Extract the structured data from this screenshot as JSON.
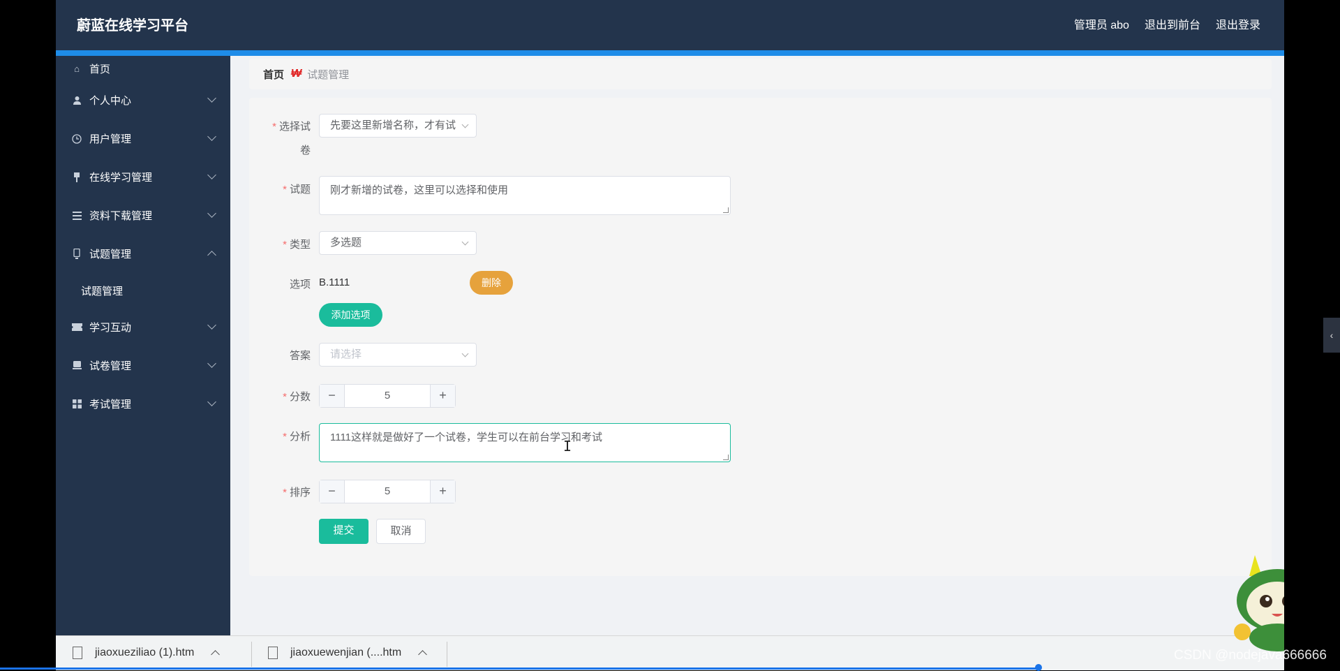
{
  "header": {
    "app_title": "蔚蓝在线学习平台",
    "admin_label": "管理员 abo",
    "back_to_front": "退出到前台",
    "logout": "退出登录"
  },
  "sidebar": {
    "items": [
      {
        "label": "首页",
        "icon": "home-icon"
      },
      {
        "label": "个人中心",
        "icon": "user-icon"
      },
      {
        "label": "用户管理",
        "icon": "clock-icon"
      },
      {
        "label": "在线学习管理",
        "icon": "pin-icon"
      },
      {
        "label": "资料下载管理",
        "icon": "list-icon"
      },
      {
        "label": "试题管理",
        "icon": "device-icon"
      },
      {
        "label": "试题管理"
      },
      {
        "label": "学习互动",
        "icon": "ticket-icon"
      },
      {
        "label": "试卷管理",
        "icon": "paper-icon"
      },
      {
        "label": "考试管理",
        "icon": "grid-icon"
      }
    ]
  },
  "breadcrumb": {
    "home": "首页",
    "current": "试题管理"
  },
  "form": {
    "paper": {
      "label_line1": "选择试",
      "label_line2": "卷",
      "value": "先要这里新增名称，才有试"
    },
    "question": {
      "label": "试题",
      "value": "刚才新增的试卷，这里可以选择和使用"
    },
    "type": {
      "label": "类型",
      "value": "多选题"
    },
    "options": {
      "label": "选项",
      "item_value": "B.1111",
      "delete_label": "删除",
      "add_label": "添加选项"
    },
    "answer": {
      "label": "答案",
      "placeholder": "请选择"
    },
    "score": {
      "label": "分数",
      "value": "5",
      "minus": "−",
      "plus": "+"
    },
    "analysis": {
      "label": "分析",
      "value": "1111这样就是做好了一个试卷，学生可以在前台学习和考试"
    },
    "order": {
      "label": "排序",
      "value": "5",
      "minus": "−",
      "plus": "+"
    },
    "required_mark": "*",
    "submit_label": "提交",
    "cancel_label": "取消"
  },
  "download_bar": {
    "files": [
      "jiaoxueziliao (1).htm",
      "jiaoxuewenjian (....htm"
    ],
    "progress": 0.85
  },
  "overlay": {
    "watermark": "CSDN @nodejava666666"
  },
  "colors": {
    "header_bg": "#23344c",
    "accent_blue": "#1e8ce8",
    "primary_green": "#1abc9c",
    "warning_orange": "#e6a23c",
    "required_red": "#f56c6c"
  }
}
